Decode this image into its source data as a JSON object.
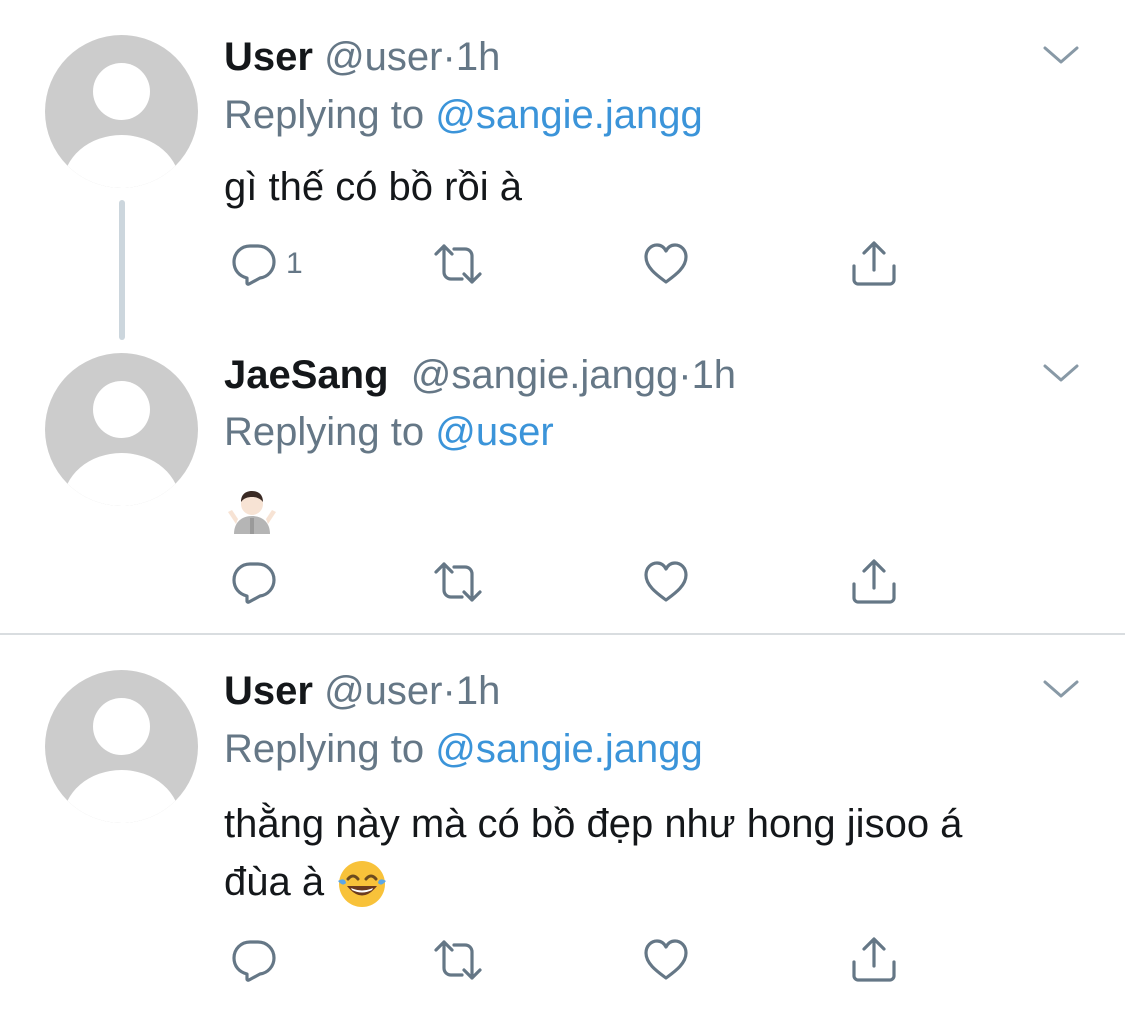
{
  "tweets": [
    {
      "name": "User",
      "handle": "@user",
      "dot": "·",
      "time": "1h",
      "reply_prefix": "Replying to ",
      "reply_mention": "@sangie.jangg",
      "text": "gì thế có bồ rồi à",
      "reply_count": "1"
    },
    {
      "name": "JaeSang",
      "handle": "@sangie.jangg",
      "dot": "·",
      "time": "1h",
      "reply_prefix": "Replying to ",
      "reply_mention": "@user",
      "text": "",
      "emoji": "person-shrugging-emoji",
      "reply_count": ""
    },
    {
      "name": "User",
      "handle": "@user",
      "dot": "·",
      "time": "1h",
      "reply_prefix": "Replying to ",
      "reply_mention": "@sangie.jangg",
      "text_line1": "thằng này mà có bồ đẹp như hong jisoo á",
      "text_line2": "đùa à",
      "emoji": "face-with-tears-of-joy-emoji",
      "reply_count": ""
    }
  ],
  "icons": {
    "reply": "reply-icon",
    "retweet": "retweet-icon",
    "like": "heart-icon",
    "share": "share-icon",
    "menu": "chevron-down-icon"
  },
  "colors": {
    "primary_text": "#14171a",
    "secondary_text": "#657786",
    "mention": "#3b94d9",
    "avatar_bg": "#cccccc",
    "thread_line": "#ccd6dd",
    "divider": "#d9dde0"
  }
}
